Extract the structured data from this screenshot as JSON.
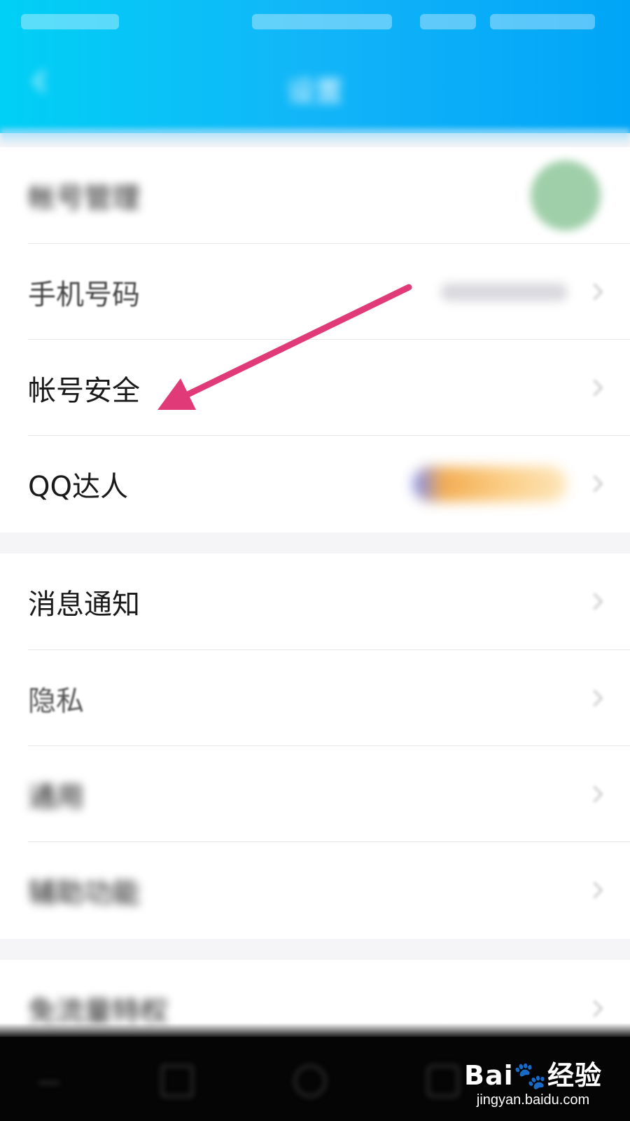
{
  "header": {
    "title": "设置",
    "back_icon": "back-arrow-icon",
    "gradient": [
      "#00d0f6",
      "#00a5f7"
    ]
  },
  "group1": {
    "items": [
      {
        "label": "帐号管理",
        "trailing": "avatar"
      },
      {
        "label": "手机号码",
        "trailing": "phone-number"
      },
      {
        "label": "帐号安全",
        "trailing": "chevron"
      },
      {
        "label": "QQ达人",
        "trailing": "badge"
      }
    ]
  },
  "group2": {
    "items": [
      {
        "label": "消息通知"
      },
      {
        "label": "隐私"
      },
      {
        "label": "通用"
      },
      {
        "label": "辅助功能"
      }
    ]
  },
  "group3": {
    "items": [
      {
        "label": "免流量特权"
      }
    ]
  },
  "annotation": {
    "color": "#e03a78",
    "target": "帐号安全"
  },
  "watermark": {
    "logo": "Bai🐾经验",
    "url": "jingyan.baidu.com"
  },
  "navbar": {
    "buttons": [
      "menu-icon",
      "back-icon",
      "home-icon",
      "recent-icon"
    ]
  }
}
